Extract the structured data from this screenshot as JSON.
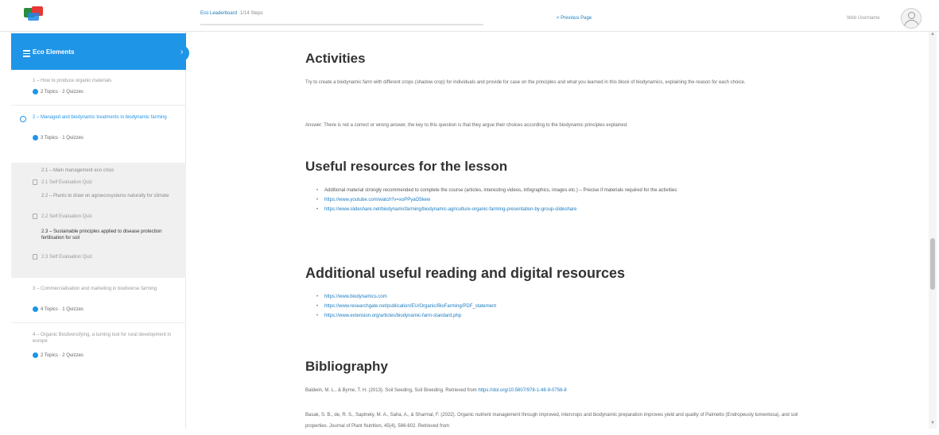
{
  "header": {
    "course_label": "Eco Leaderboard",
    "step_label": "1/14 Steps",
    "prev_label": "< Previous Page",
    "user_name": "Web Username"
  },
  "sidebar": {
    "title": "Eco Elements",
    "lessons": [
      {
        "title": "1 – How to produce organic materials",
        "meta": "2 Topics · 2 Quizzes",
        "active": false
      },
      {
        "title": "2 – Managed and biodynamic treatments in biodynamic farming",
        "meta": "3 Topics · 1 Quizzes",
        "active": true
      },
      {
        "title": "3 – Commercialisation and marketing in biodiverse farming",
        "meta": "4 Topics · 1 Quizzes",
        "active": false
      },
      {
        "title": "4 – Organic Biodiversifying, a turning tool for rural development in europe",
        "meta": "2 Topics · 2 Quizzes",
        "active": false
      }
    ],
    "topics": [
      {
        "label": "2.1 – Main management eco crisis",
        "current": false
      },
      {
        "label": "2.2 – Plants to draw on agroecosystems naturally for climate",
        "current": false
      },
      {
        "label": "2.3 – Sustainable principles applied to disease protection fertilisation for soil",
        "current": true
      }
    ],
    "quizzes": [
      "2.1 Self Evaluation Quiz",
      "2.2 Self Evaluation Quiz",
      "2.3 Self Evaluation Quiz"
    ]
  },
  "main": {
    "activities_heading": "Activities",
    "activities_text": "Try to create a biodynamic farm with different crops (shadow crop) for individuals and provide for case on the principles and what you learned in this block of biodynamics, explaining the reason for each choice.",
    "answer_text": "Answer: There is not a correct or wrong answer, the key to this question is that they argue their choices according to the biodynamic principles explained.",
    "useful_heading": "Useful resources for the lesson",
    "useful_items": [
      "Additional material strongly recommended to complete the course (articles, interesting videos, infographics, images etc.) – Precise if materials required for the activities",
      "https://www.youtube.com/watch?v=xoPPyaO5kew",
      "https://www.slideshare.net/biodynamicfarming/biodynamic-agriculture-organic-farming-presentation-by-group-slideshare"
    ],
    "additional_heading": "Additional useful reading and digital resources",
    "additional_items": [
      "https://www.biodynamics.com",
      "https://www.researchgate.net/publication/EU/Organic/BioFarming/PDF_statement",
      "https://www.extension.org/articles/biodynamic-farm-standard.php"
    ],
    "bibliography_heading": "Bibliography",
    "bib1_text": "Baldwin, M. L., & Byrne, T. H. (2013). Soil Seeding, Soil Breeding. Retrieved from ",
    "bib1_link": "https://doi.org/10.5607/978-1-48-9-0756-8",
    "bib2_text": "Basak, S. B., de, R. S., Saptnety, M. A., Saha, A., & Sharmal, F. (2022). Organic nutrient management through improved, intercrops and biodynamic preparation improves yield and quality of Palmetto (Endropeusly tomentosa), and soil properties. Journal of Plant Nutrition, 45(4), 586-602. Retrieved from"
  },
  "colors": {
    "accent": "#1f95e8",
    "link": "#1a7bc0",
    "sidebar_topics_bg": "#f0f0f0"
  }
}
